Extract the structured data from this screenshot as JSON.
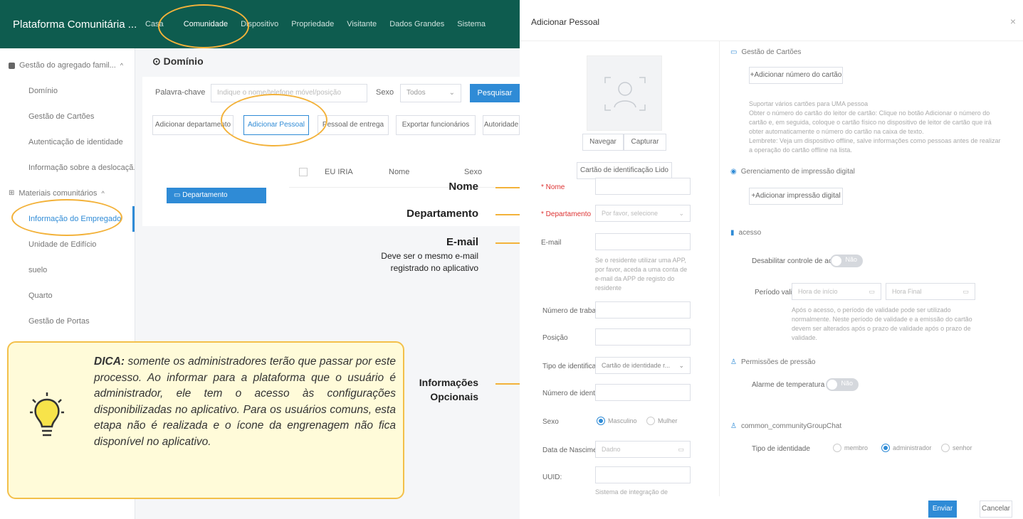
{
  "app": {
    "brand": "Plataforma Comunitária ...",
    "nav": [
      "Casa",
      "Comunidade",
      "Dispositivo",
      "Propriedade",
      "Visitante",
      "Dados Grandes",
      "Sistema"
    ]
  },
  "sidebar": {
    "group1": "Gestão do agregado famil...",
    "items1": [
      "Domínio",
      "Gestão de Cartões",
      "Autenticação de identidade",
      "Informação sobre a deslocaçã..."
    ],
    "group2": "Materiais comunitários",
    "items2": [
      "Informação do Empregado",
      "Unidade de Edifício",
      "suelo",
      "Quarto",
      "Gestão de Portas"
    ]
  },
  "main": {
    "title": "Domínio",
    "keyword_label": "Palavra-chave",
    "keyword_placeholder": "Indique o nome/telefone móvel/posição",
    "sex_label": "Sexo",
    "sex_value": "Todos",
    "search": "Pesquisar",
    "actions": [
      "Adicionar departamento",
      "Adicionar Pessoal",
      "Pessoal de entrega",
      "Exportar funcionários",
      "Autoridade"
    ],
    "tree_dept": "Departamento",
    "table_headers": [
      "EU IRIA",
      "Nome",
      "Sexo"
    ]
  },
  "tip": {
    "bold": "DICA:",
    "text": " somente os administradores terão que passar por este processo. Ao informar para a plataforma que o usuário é administrador, ele tem o acesso às configurações disponibilizadas no aplicativo. Para os usuários comuns, esta etapa não é realizada e o ícone da engrenagem não fica disponível no aplicativo."
  },
  "annotations": {
    "nome": "Nome",
    "departamento": "Departamento",
    "email": "E-mail",
    "email_note_1": "Deve ser o mesmo e-mail",
    "email_note_2": "registrado no aplicativo",
    "opt_1": "Informações",
    "opt_2": "Opcionais"
  },
  "modal": {
    "title": "Adicionar Pessoal",
    "close": "×",
    "browse": "Navegar",
    "capture": "Capturar",
    "read_id": "Cartão de identificação Lido",
    "name_label": "* Nome",
    "dept_label": "* Departamento",
    "dept_placeholder": "Por favor, selecione",
    "email_label": "E-mail",
    "email_help": "Se o residente utilizar uma APP, por favor, aceda a uma conta de e-mail da APP de registo do residente",
    "job_no_label": "Número de trabalh",
    "position_label": "Posição",
    "id_type_label": "Tipo de identificaçã",
    "id_type_value": "Cartão de identidade r...",
    "id_no_label": "Número de identifi",
    "sex_label": "Sexo",
    "male": "Masculino",
    "female": "Mulher",
    "birth_label": "Data de Nasciment",
    "birth_placeholder": "Dadno",
    "uuid_label": "UUID:",
    "uuid_help": "Sistema de integração de",
    "card_section": "Gestão de Cartões",
    "add_card": "+Adicionar número do cartão",
    "card_help_1": "Suportar vários cartões para UMA pessoa",
    "card_help_2": "Obter o número do cartão do leitor de cartão: Clique no botão Adicionar o número do cartão e, em seguida, coloque o cartão físico no dispositivo de leitor de cartão que irá obter automaticamente o número do cartão na caixa de texto.",
    "card_help_3": "Lembrete: Veja um dispositivo offline, salve informações como pessoas antes de realizar a operação do cartão offline na lista.",
    "fp_section": "Gerenciamento de impressão digital",
    "add_fp": "+Adicionar impressão digital",
    "access_section": "acesso",
    "disable_access": "Desabilitar controle de acesso",
    "no": "Não",
    "validity_label": "Período valido",
    "start_time": "Hora de início",
    "end_time": "Hora Final",
    "validity_help": "Após o acesso, o período de validade pode ser utilizado normalmente. Neste período de validade e a emissão do cartão devem ser alterados após o prazo de validade após o prazo de validade.",
    "pressure_section": "Permissões de pressão",
    "temp_alarm": "Alarme de temperatura norm",
    "group_section": "common_communityGroupChat",
    "identity_type": "Tipo de identidade",
    "member": "membro",
    "admin": "administrador",
    "senior": "senhor",
    "submit": "Enviar",
    "cancel": "Cancelar"
  }
}
